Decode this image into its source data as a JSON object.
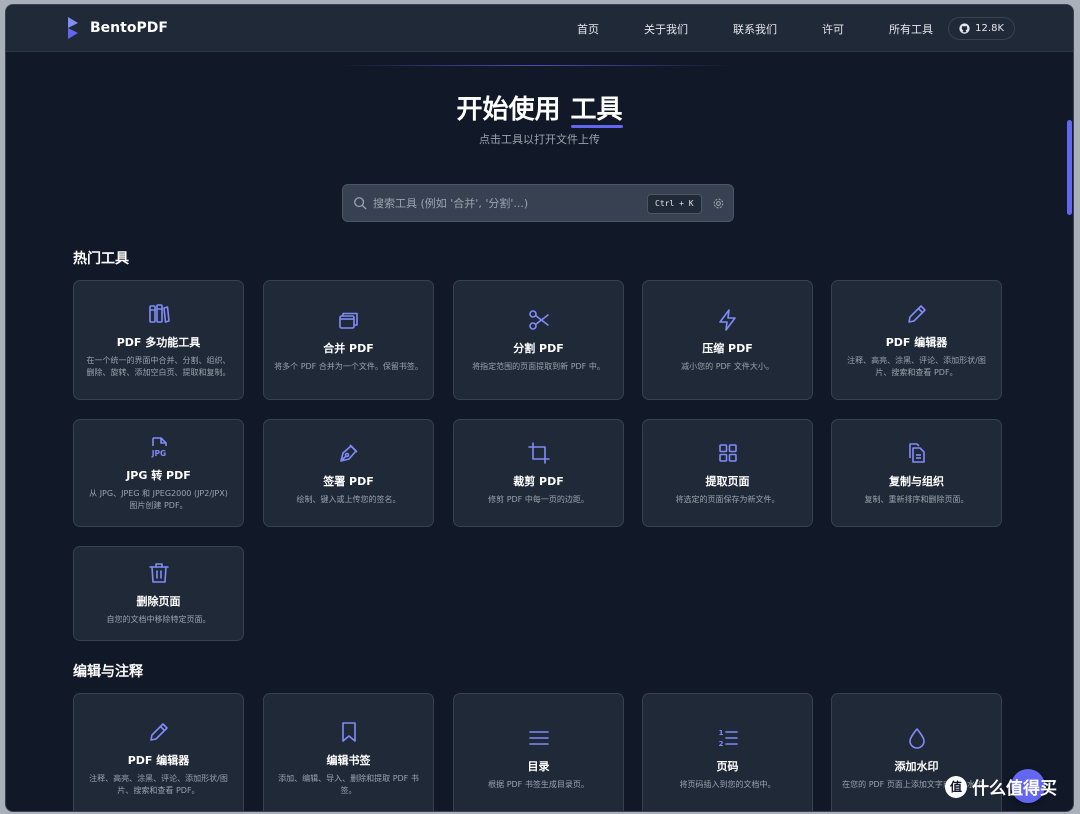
{
  "app": {
    "name": "BentoPDF"
  },
  "nav": {
    "items": [
      "首页",
      "关于我们",
      "联系我们",
      "许可",
      "所有工具"
    ]
  },
  "github": {
    "stars": "12.8K"
  },
  "hero": {
    "title": "开始使用",
    "title_highlight": "工具",
    "subtitle": "点击工具以打开文件上传"
  },
  "search": {
    "placeholder": "搜索工具 (例如 '合并', '分割'...)",
    "shortcut": "Ctrl + K"
  },
  "sections": {
    "popular": {
      "title": "热门工具",
      "cards": [
        {
          "title": "PDF 多功能工具",
          "desc": "在一个统一的界面中合并、分割、组织、删除、旋转、添加空白页、提取和复制。",
          "icon": "multi-tool-icon"
        },
        {
          "title": "合并 PDF",
          "desc": "将多个 PDF 合并为一个文件。保留书签。",
          "icon": "merge-icon"
        },
        {
          "title": "分割 PDF",
          "desc": "将指定范围的页面提取到新 PDF 中。",
          "icon": "scissors-icon"
        },
        {
          "title": "压缩 PDF",
          "desc": "减小您的 PDF 文件大小。",
          "icon": "lightning-icon"
        },
        {
          "title": "PDF 编辑器",
          "desc": "注释、高亮、涂黑、评论、添加形状/图片、搜索和查看 PDF。",
          "icon": "pencil-icon"
        },
        {
          "title": "JPG 转 PDF",
          "desc": "从 JPG、JPEG 和 JPEG2000 (JP2/JPX) 图片创建 PDF。",
          "icon": "jpg-file-icon"
        },
        {
          "title": "签署 PDF",
          "desc": "绘制、键入或上传您的签名。",
          "icon": "pen-nib-icon"
        },
        {
          "title": "裁剪 PDF",
          "desc": "修剪 PDF 中每一页的边距。",
          "icon": "crop-icon"
        },
        {
          "title": "提取页面",
          "desc": "将选定的页面保存为新文件。",
          "icon": "grid-icon"
        },
        {
          "title": "复制与组织",
          "desc": "复制、重新排序和删除页面。",
          "icon": "copy-pages-icon"
        },
        {
          "title": "删除页面",
          "desc": "自您的文档中移除特定页面。",
          "icon": "trash-icon"
        }
      ]
    },
    "edit": {
      "title": "编辑与注释",
      "cards": [
        {
          "title": "PDF 编辑器",
          "desc": "注释、高亮、涂黑、评论、添加形状/图片、搜索和查看 PDF。",
          "icon": "pencil-icon"
        },
        {
          "title": "编辑书签",
          "desc": "添加、编辑、导入、删除和提取 PDF 书签。",
          "icon": "bookmark-icon"
        },
        {
          "title": "目录",
          "desc": "根据 PDF 书签生成目录页。",
          "icon": "list-icon"
        },
        {
          "title": "页码",
          "desc": "将页码插入到您的文档中。",
          "icon": "numbered-list-icon"
        },
        {
          "title": "添加水印",
          "desc": "在您的 PDF 页面上添加文字或图片水印。",
          "icon": "droplet-icon"
        }
      ]
    }
  },
  "watermark": {
    "logo": "值",
    "text": "什么值得买"
  },
  "colors": {
    "accent": "#6366f1",
    "background": "#111827",
    "card": "#1f2937"
  }
}
